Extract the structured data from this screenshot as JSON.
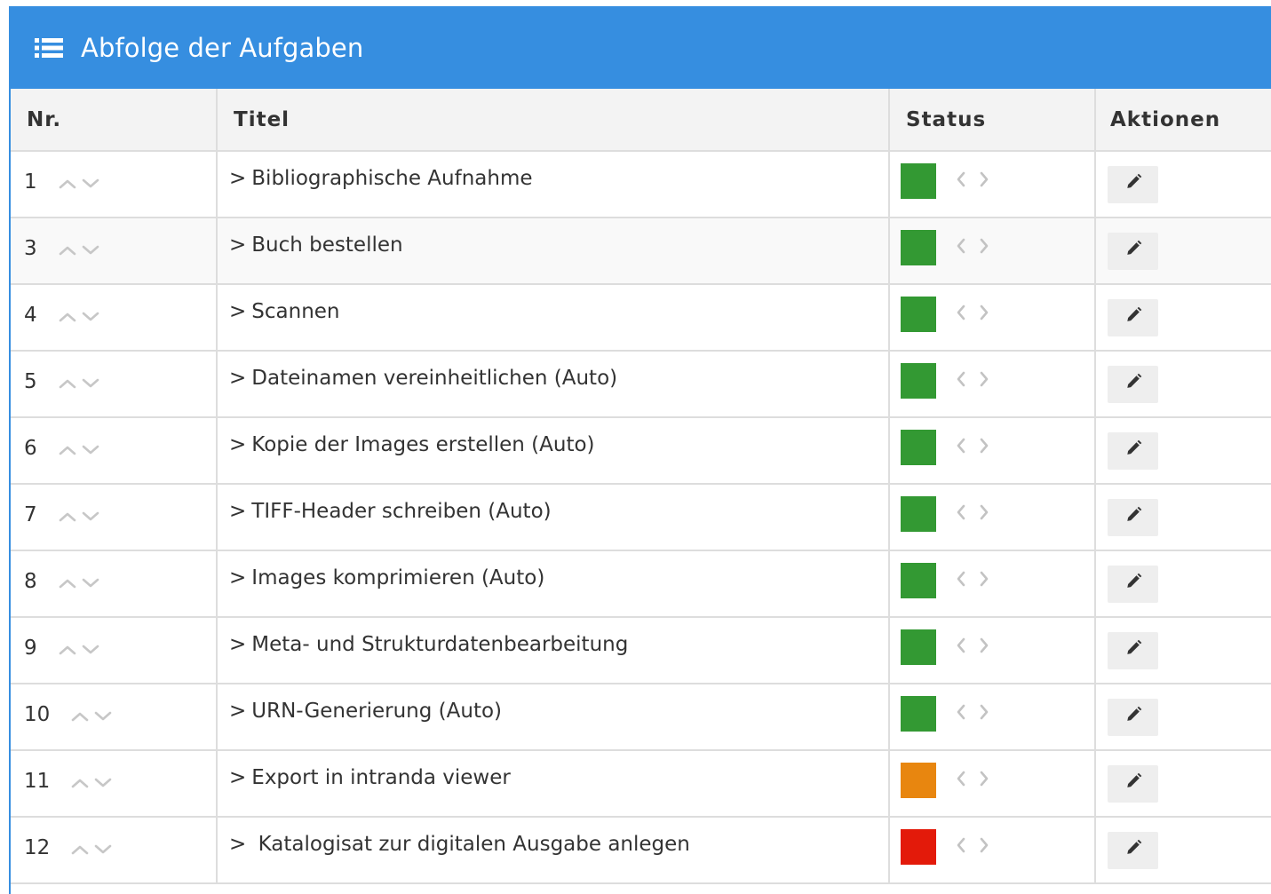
{
  "panel": {
    "title": "Abfolge der Aufgaben",
    "icon": "list-icon"
  },
  "columns": {
    "nr": "Nr.",
    "title": "Titel",
    "status": "Status",
    "actions": "Aktionen"
  },
  "colors": {
    "header": "#368ee0",
    "done": "#339933",
    "in_progress": "#e8860f",
    "locked": "#e31a0a"
  },
  "rows": [
    {
      "nr": "1",
      "title": "Bibliographische Aufnahme",
      "status": "done"
    },
    {
      "nr": "3",
      "title": "Buch bestellen",
      "status": "done"
    },
    {
      "nr": "4",
      "title": "Scannen",
      "status": "done"
    },
    {
      "nr": "5",
      "title": "Dateinamen vereinheitlichen (Auto)",
      "status": "done"
    },
    {
      "nr": "6",
      "title": "Kopie der Images erstellen (Auto)",
      "status": "done"
    },
    {
      "nr": "7",
      "title": "TIFF-Header schreiben (Auto)",
      "status": "done"
    },
    {
      "nr": "8",
      "title": "Images komprimieren (Auto)",
      "status": "done"
    },
    {
      "nr": "9",
      "title": "Meta- und Strukturdatenbearbeitung",
      "status": "done"
    },
    {
      "nr": "10",
      "title": "URN-Generierung (Auto)",
      "status": "done"
    },
    {
      "nr": "11",
      "title": "Export in intranda viewer",
      "status": "in_progress"
    },
    {
      "nr": "12",
      "title": " Katalogisat zur digitalen Ausgabe anlegen",
      "status": "locked"
    }
  ]
}
